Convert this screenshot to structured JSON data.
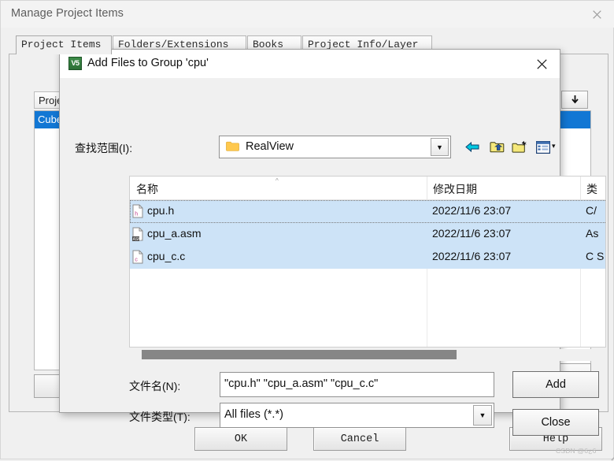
{
  "window": {
    "title": "Manage Project Items",
    "close_icon": "close-icon",
    "tabs": [
      {
        "label": "Project Items",
        "active": true
      },
      {
        "label": "Folders/Extensions",
        "active": false
      },
      {
        "label": "Books",
        "active": false
      },
      {
        "label": "Project Info/Layer",
        "active": false
      }
    ],
    "background_panels": {
      "left_label": "Proje",
      "left_selected_item": "Cube",
      "right_button_icon": "arrow-down-icon"
    },
    "buttons": {
      "ok": "OK",
      "cancel": "Cancel",
      "help": "Help"
    },
    "watermark": "CSDN @6¿6"
  },
  "dialog": {
    "title": "Add Files to Group 'cpu'",
    "icon_text": "V5",
    "icon_name": "keil-uvision-icon",
    "close_icon": "close-icon",
    "lookin": {
      "label": "查找范围(I):",
      "value": "RealView",
      "folder_icon": "folder-icon",
      "dropdown_icon": "chevron-down-icon"
    },
    "toolbar": {
      "back": "back-arrow-icon",
      "up": "up-one-level-icon",
      "new_folder": "new-folder-icon",
      "views": "views-icon",
      "views_caret": "▾"
    },
    "filelist": {
      "columns": [
        "名称",
        "修改日期",
        "类"
      ],
      "sort_indicator": "^",
      "rows": [
        {
          "name": "cpu.h",
          "date": "2022/11/6 23:07",
          "type": "C/",
          "icon": "h-file-icon",
          "selected": true,
          "focused": true
        },
        {
          "name": "cpu_a.asm",
          "date": "2022/11/6 23:07",
          "type": "As",
          "icon": "asm-file-icon",
          "selected": true,
          "focused": false
        },
        {
          "name": "cpu_c.c",
          "date": "2022/11/6 23:07",
          "type": "C S",
          "icon": "c-file-icon",
          "selected": true,
          "focused": false
        }
      ],
      "scrollbar": "horizontal-scrollbar"
    },
    "form": {
      "filename_label": "文件名(N):",
      "filename_value": "\"cpu.h\" \"cpu_a.asm\" \"cpu_c.c\"",
      "filetype_label": "文件类型(T):",
      "filetype_value": "All files (*.*)",
      "filetype_dropdown_icon": "chevron-down-icon"
    },
    "buttons": {
      "add": "Add",
      "close": "Close"
    },
    "resize_grip": "resize-grip-icon"
  },
  "colors": {
    "selection_blue": "#cde3f7",
    "nav_selection": "#1277d4",
    "folder_yellow": "#ffc84d",
    "dialog_bg": "#f0f0f0"
  }
}
